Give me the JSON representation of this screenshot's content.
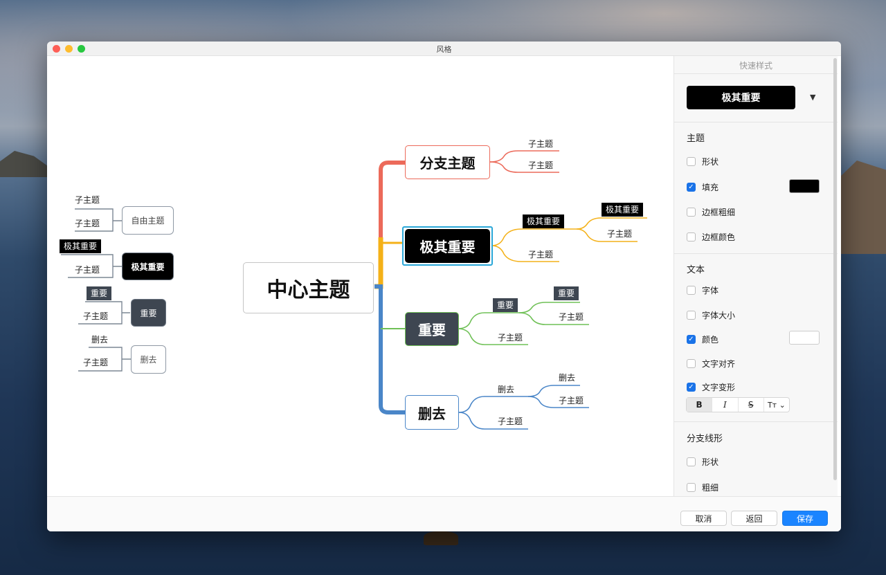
{
  "window": {
    "title": "风格"
  },
  "mindmap": {
    "center": "中心主题",
    "branches": [
      {
        "label": "分支主题",
        "color": "#ec6a5a",
        "children": [
          "子主题",
          "子主题"
        ]
      },
      {
        "label": "极其重要",
        "color": "#f4b118",
        "children": [
          "极其重要",
          "子主题"
        ],
        "sub_tag": "极其重要",
        "sub_children": [
          "子主题"
        ]
      },
      {
        "label": "重要",
        "color": "#6fc056",
        "children": [
          "重要",
          "子主题"
        ],
        "sub_tag": "重要",
        "sub_children": [
          "子主题"
        ]
      },
      {
        "label": "删去",
        "color": "#4a86c8",
        "children": [
          "删去",
          "子主题"
        ],
        "sub_tag": "删去",
        "sub_children": [
          "子主题"
        ]
      }
    ],
    "legend": [
      {
        "label": "自由主题",
        "items": [
          "子主题",
          "子主题"
        ]
      },
      {
        "label": "极其重要",
        "items": [
          "极其重要",
          "子主题"
        ]
      },
      {
        "label": "重要",
        "items": [
          "重要",
          "子主题"
        ]
      },
      {
        "label": "删去",
        "items": [
          "删去",
          "子主题"
        ]
      }
    ]
  },
  "panel": {
    "header": "快速样式",
    "style_select": "极其重要",
    "dropdown_arrow": "▼",
    "sections": {
      "topic": {
        "title": "主题",
        "shape": "形状",
        "fill": "填充",
        "border_width": "边框粗细",
        "border_color": "边框颜色"
      },
      "text": {
        "title": "文本",
        "font": "字体",
        "font_size": "字体大小",
        "color": "颜色",
        "align": "文字对齐",
        "transform": "文字变形"
      },
      "branch": {
        "title": "分支线形",
        "shape": "形状",
        "width": "粗细"
      }
    },
    "checked": {
      "fill": true,
      "color": true,
      "transform": true
    },
    "fill_color": "#000000",
    "text_color": "#ffffff",
    "format_buttons": {
      "bold": "B",
      "italic": "I",
      "strike": "S",
      "case": "Tт ⌄"
    }
  },
  "footer": {
    "cancel": "取消",
    "back": "返回",
    "save": "保存"
  },
  "colors": {
    "accent": "#1a84ff",
    "selection": "#2aa7d8"
  }
}
